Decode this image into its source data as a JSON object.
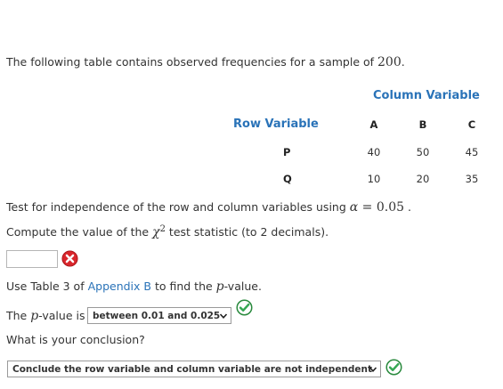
{
  "intro": {
    "text": "The following table contains observed frequencies for a sample of ",
    "sample_size": "200",
    "end": "."
  },
  "table": {
    "column_variable_label": "Column Variable",
    "row_variable_label": "Row Variable",
    "columns": [
      "A",
      "B",
      "C"
    ],
    "rows": [
      {
        "label": "P",
        "values": [
          "40",
          "50",
          "45"
        ]
      },
      {
        "label": "Q",
        "values": [
          "10",
          "20",
          "35"
        ]
      }
    ]
  },
  "test": {
    "text": "Test for independence of the row and column variables using ",
    "alpha_symbol": "α",
    "equals": " = ",
    "alpha_value": "0.05",
    "end": " ."
  },
  "compute": {
    "before": "Compute the value of the ",
    "chi": "χ",
    "squared": "2",
    "after": " test statistic (to 2 decimals)."
  },
  "answer_input": {
    "value": "",
    "status": "incorrect"
  },
  "table_ref": {
    "before": "Use Table 3 of ",
    "link": "Appendix B",
    "middle": " to find the ",
    "p": "p",
    "after": "-value."
  },
  "pvalue": {
    "before": "The ",
    "p": "p",
    "after": "-value is",
    "selected": "between 0.01 and 0.025",
    "status": "correct"
  },
  "conclusion": {
    "question": "What is your conclusion?",
    "selected": "Conclude the row variable and column variable are not independent",
    "status": "correct"
  },
  "colors": {
    "accent": "#2a73b8",
    "correct": "#35a853",
    "incorrect": "#d9262c"
  },
  "icons": {
    "incorrect": "x-circle-icon",
    "correct": "check-circle-icon",
    "dropdown": "chevron-down-icon"
  }
}
